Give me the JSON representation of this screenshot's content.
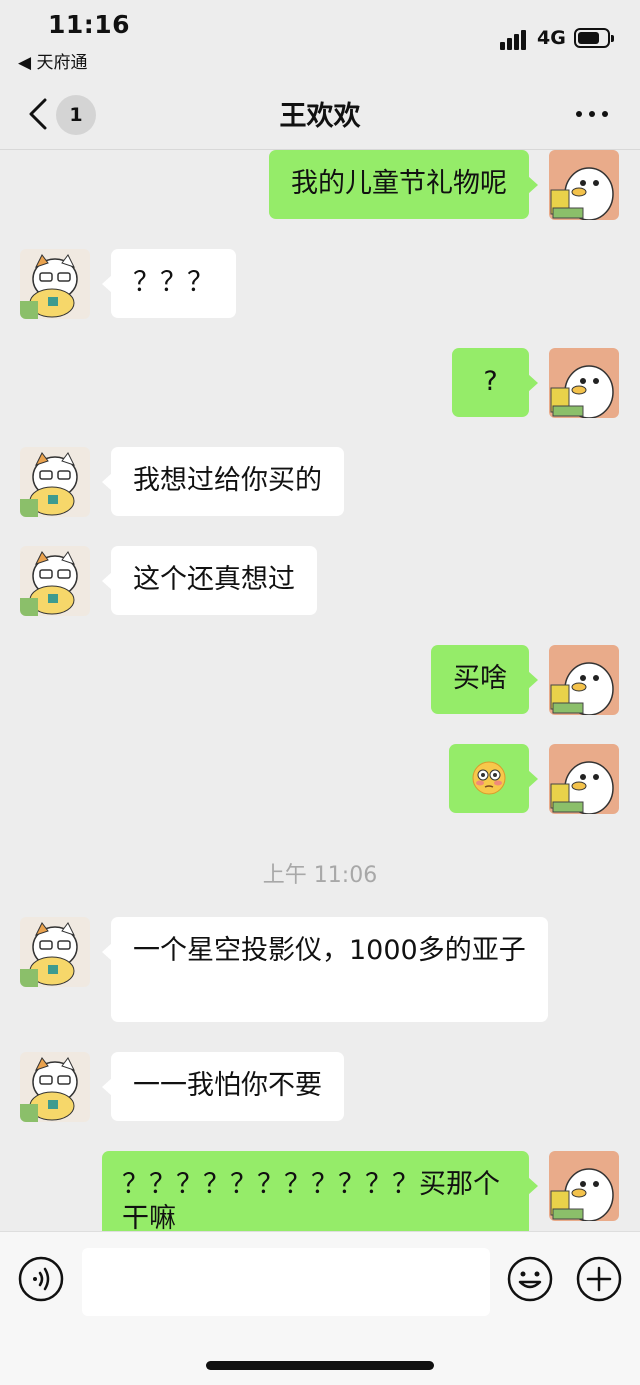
{
  "status_bar": {
    "time": "11:16",
    "back_app": "◀ 天府通",
    "network": "4G",
    "battery_level": 0.75
  },
  "nav": {
    "title": "王欢欢",
    "unread_count": "1"
  },
  "messages": [
    {
      "type": "text",
      "side": "out",
      "text": "我的儿童节礼物呢"
    },
    {
      "type": "text",
      "side": "in",
      "text": "？？？"
    },
    {
      "type": "text",
      "side": "out",
      "text": "?"
    },
    {
      "type": "text",
      "side": "in",
      "text": "我想过给你买的"
    },
    {
      "type": "text",
      "side": "in",
      "text": "这个还真想过"
    },
    {
      "type": "text",
      "side": "out",
      "text": "买啥"
    },
    {
      "type": "emoji",
      "side": "out",
      "icon": "flushed-face-emoji"
    },
    {
      "type": "time",
      "text": "上午 11:06"
    },
    {
      "type": "text",
      "side": "in",
      "text": "一个星空投影仪，1000多的亚子"
    },
    {
      "type": "text",
      "side": "in",
      "text": "一一我怕你不要"
    },
    {
      "type": "text",
      "side": "out",
      "text": "？？？？？？？？？？？买那个干嘛"
    }
  ],
  "input": {
    "placeholder": ""
  },
  "colors": {
    "background": "#ededed",
    "bubble_out": "#95ec69",
    "bubble_in": "#ffffff",
    "timestamp": "#a8a8a8"
  }
}
